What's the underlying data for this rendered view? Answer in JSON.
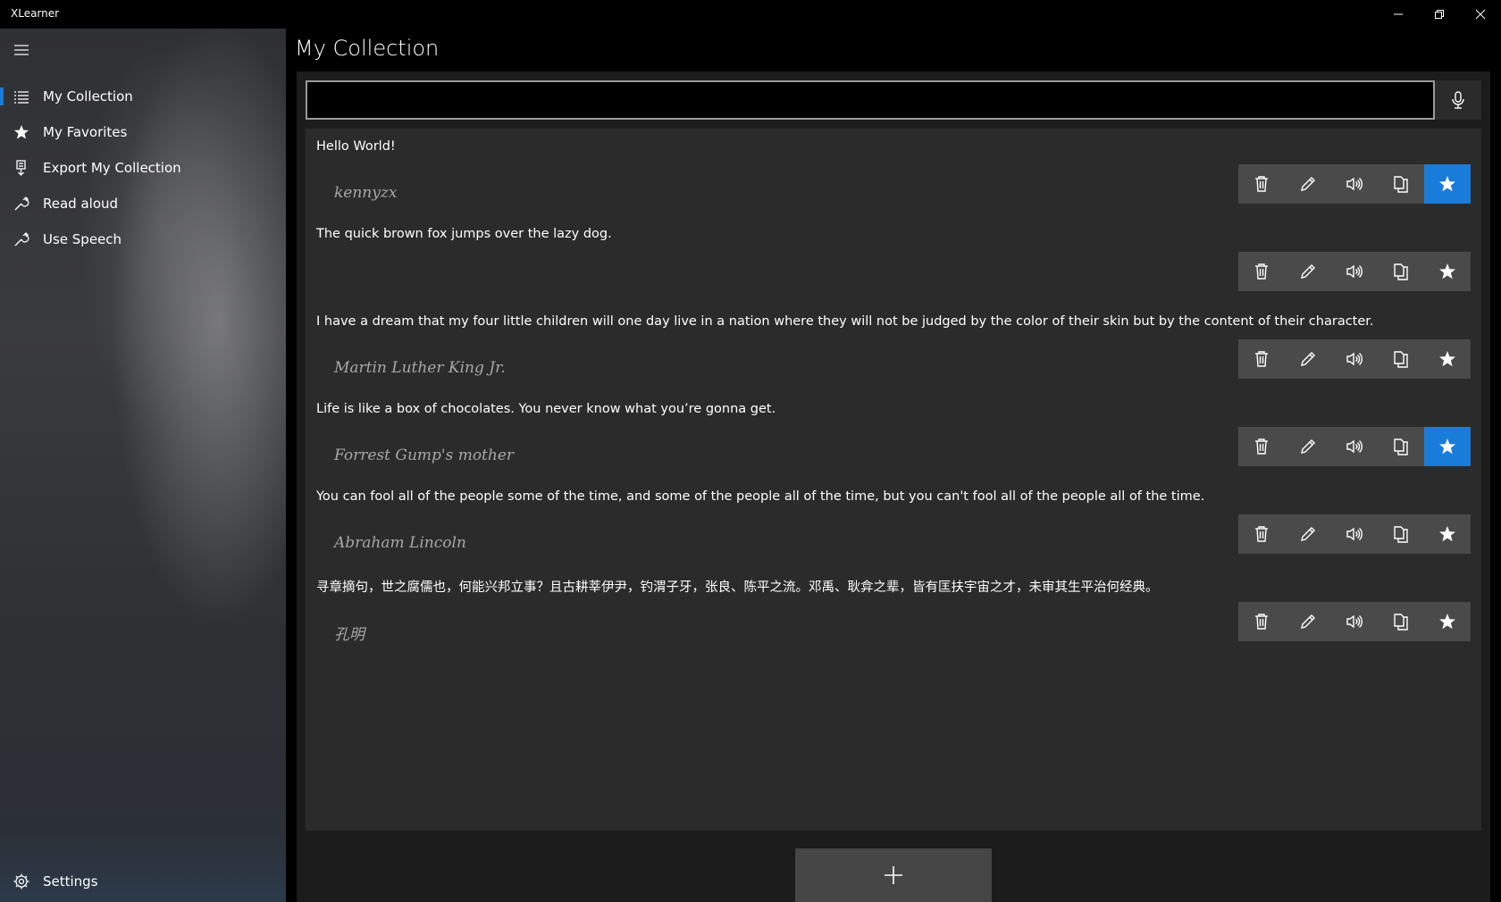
{
  "app": {
    "title": "XLearner",
    "page_title": "My Collection",
    "accent": "#1a7cd9"
  },
  "window_controls": {
    "minimize_icon": "minimize-icon",
    "restore_icon": "restore-icon",
    "close_icon": "close-icon"
  },
  "sidebar": {
    "items": [
      {
        "label": "My Collection",
        "icon": "list-icon",
        "selected": true
      },
      {
        "label": "My Favorites",
        "icon": "star-icon",
        "selected": false
      },
      {
        "label": "Export My Collection",
        "icon": "export-icon",
        "selected": false
      },
      {
        "label": "Read aloud",
        "icon": "wrench-icon",
        "selected": false
      },
      {
        "label": "Use Speech",
        "icon": "wrench-icon",
        "selected": false
      }
    ],
    "settings_label": "Settings"
  },
  "search": {
    "value": "",
    "placeholder": ""
  },
  "collection": [
    {
      "text": "Hello World!",
      "author": "kennyzx",
      "favorite": true
    },
    {
      "text": "The quick brown fox jumps over the lazy dog.",
      "author": "",
      "favorite": false
    },
    {
      "text": "I have a dream that my four little children will one day live in a nation where they will not be judged by the color of their skin but by the content of their character.",
      "author": "Martin Luther King Jr.",
      "favorite": false
    },
    {
      "text": "Life is like a box of chocolates. You never know what you’re gonna get.",
      "author": "Forrest Gump's mother",
      "favorite": true
    },
    {
      "text": "You can fool all of the people some of the time, and some of the people all of the time, but you can't fool all of the people all of the time.",
      "author": "Abraham Lincoln",
      "favorite": false
    },
    {
      "text": "寻章摘句，世之腐儒也，何能兴邦立事？且古耕莘伊尹，钓渭子牙，张良、陈平之流。邓禹、耿弇之辈，皆有匡扶宇宙之才，未审其生平治何经典。",
      "author": "孔明",
      "favorite": false
    }
  ]
}
